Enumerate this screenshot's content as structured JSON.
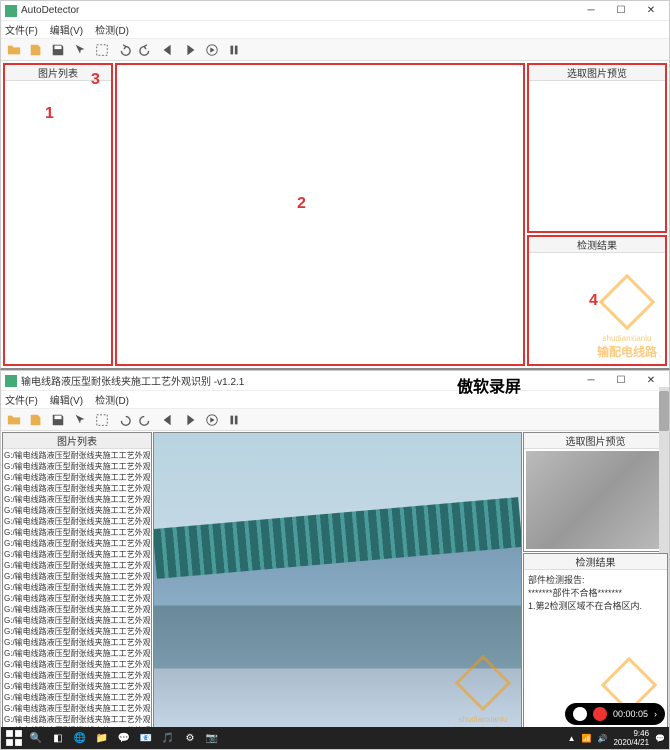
{
  "app1": {
    "title": "AutoDetector",
    "menu": {
      "file": "文件(F)",
      "edit": "编辑(V)",
      "detect": "检测(D)"
    },
    "panels": {
      "left_hdr": "图片列表",
      "right_top_hdr": "选取图片预览",
      "right_bot_hdr": "检测结果"
    },
    "nums": {
      "n1": "1",
      "n2": "2",
      "n3": "3",
      "n4": "4"
    }
  },
  "app2": {
    "title": "输电线路液压型耐张线夹施工工艺外观识别 -v1.2.1",
    "menu": {
      "file": "文件(F)",
      "edit": "编辑(V)",
      "detect": "检测(D)"
    },
    "panels": {
      "left_hdr": "图片列表",
      "preview_hdr": "选取图片预览",
      "result_hdr": "检测结果"
    },
    "result": {
      "line1": "部件检测报告:",
      "line2": "*******部件不合格*******",
      "line3": "1.第2检测区域不在合格区内."
    },
    "files": [
      "G:/输电线路液压型耐张线夹施工工艺外观识别方法研究与自动识别工具",
      "G:/输电线路液压型耐张线夹施工工艺外观识别方法研究与自动识别工具",
      "G:/输电线路液压型耐张线夹施工工艺外观识别方法研究与自动识别工具",
      "G:/输电线路液压型耐张线夹施工工艺外观识别方法研究与自动识别工具",
      "G:/输电线路液压型耐张线夹施工工艺外观识别方法研究与自动识别工具",
      "G:/输电线路液压型耐张线夹施工工艺外观识别方法研究与自动识别工具",
      "G:/输电线路液压型耐张线夹施工工艺外观识别方法研究与自动识别工具",
      "G:/输电线路液压型耐张线夹施工工艺外观识别方法研究与自动识别工具",
      "G:/输电线路液压型耐张线夹施工工艺外观识别方法研究与自动识别工具",
      "G:/输电线路液压型耐张线夹施工工艺外观识别方法研究与自动识别工具",
      "G:/输电线路液压型耐张线夹施工工艺外观识别方法研究与自动识别工具",
      "G:/输电线路液压型耐张线夹施工工艺外观识别方法研究与自动识别工具",
      "G:/输电线路液压型耐张线夹施工工艺外观识别方法研究与自动识别工具",
      "G:/输电线路液压型耐张线夹施工工艺外观识别方法研究与自动识别工具",
      "G:/输电线路液压型耐张线夹施工工艺外观识别方法研究与自动识别工具",
      "G:/输电线路液压型耐张线夹施工工艺外观识别方法研究与自动识别工具",
      "G:/输电线路液压型耐张线夹施工工艺外观识别方法研究与自动识别工具",
      "G:/输电线路液压型耐张线夹施工工艺外观识别方法研究与自动识别工具",
      "G:/输电线路液压型耐张线夹施工工艺外观识别方法研究与自动识别工具",
      "G:/输电线路液压型耐张线夹施工工艺外观识别方法研究与自动识别工具",
      "G:/输电线路液压型耐张线夹施工工艺外观识别方法研究与自动识别工具",
      "G:/输电线路液压型耐张线夹施工工艺外观识别方法研究与自动识别工具",
      "G:/输电线路液压型耐张线夹施工工艺外观识别方法研究与自动识别工具",
      "G:/输电线路液压型耐张线夹施工工艺外观识别方法研究与自动识别工具",
      "G:/输电线路液压型耐张线夹施工工艺外观识别方法研究与自动识别工具",
      "G:/输电线路液压型耐张线夹施工工艺外观识别方法研究与自动识别工具"
    ],
    "recorder_tag": "傲软录屏",
    "rec_time": "00:00:05",
    "clock": {
      "time": "9:46",
      "date": "2020/4/21"
    }
  },
  "watermark": {
    "pinyin": "shudianxianlu",
    "cn": "输配电线路"
  }
}
